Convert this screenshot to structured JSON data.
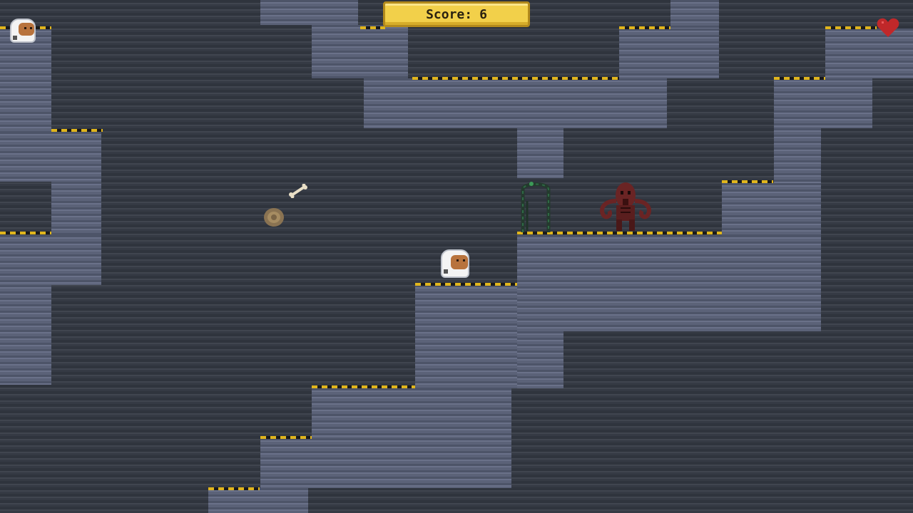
{
  "hud": {
    "score_label": "Score:",
    "score_value": "6",
    "lives": 1
  },
  "entities": {
    "player": "astronaut",
    "extra_life_icon": "astronaut-head-icon",
    "enemy": "red-tentacle-monster",
    "exit": "vine-covered-gate",
    "pickups": [
      "rock-icon",
      "bone-icon"
    ]
  },
  "colors": {
    "score_panel": "#f2d04a",
    "heart": "#c0282a",
    "ledge_stripe_a": "#e0b51c",
    "ledge_stripe_b": "#1a1a1a",
    "wall": "#5b6278",
    "background": "#3a3f49",
    "monster": "#6a2424"
  }
}
